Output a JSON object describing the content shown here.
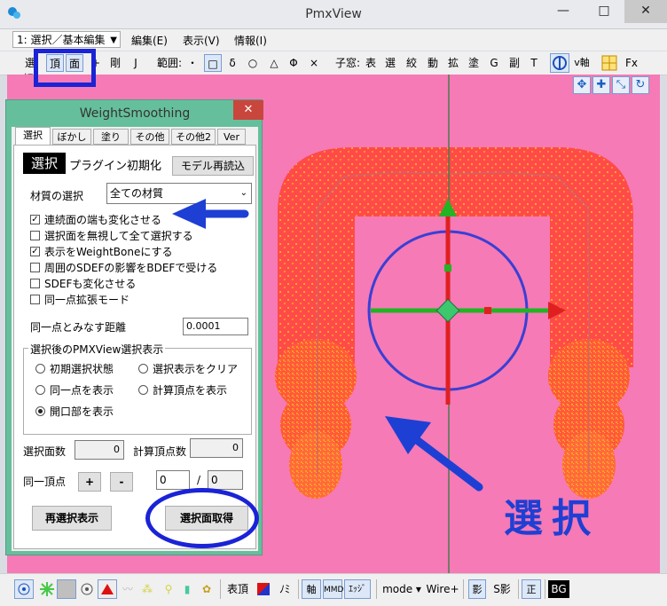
{
  "window": {
    "title": "PmxView",
    "minimize": "—",
    "maximize": "□",
    "close": "✕"
  },
  "menu": {
    "mode_select": "1: 選択／基本編集",
    "items": [
      "編集(E)",
      "表示(V)",
      "情報(I)"
    ]
  },
  "toolbar": {
    "select_label": "選択:",
    "vertex": "頂",
    "face": "面",
    "plus": "+",
    "rigid": "剛",
    "joint": "J",
    "range_label": "範囲:",
    "range_items": [
      "・",
      "□",
      "δ",
      "○",
      "△",
      "Φ",
      "×"
    ],
    "child_label": "子窓:",
    "child_items": [
      "表",
      "選",
      "絞",
      "動",
      "拡",
      "塗",
      "G",
      "副",
      "T"
    ],
    "axis": "v軸",
    "fx": "Fx"
  },
  "dialog": {
    "title": "WeightSmoothing",
    "close": "✕",
    "tabs": [
      "選択",
      "ぼかし",
      "塗り",
      "その他",
      "その他2",
      "Ver"
    ],
    "select_label": "選択",
    "plugin_init": "プラグイン初期化",
    "reload_button": "モデル再読込",
    "material_label": "材質の選択",
    "material_value": "全ての材質",
    "checkboxes": [
      {
        "label": "連続面の端も変化させる",
        "checked": true
      },
      {
        "label": "選択面を無視して全て選択する",
        "checked": false
      },
      {
        "label": "表示をWeightBoneにする",
        "checked": true
      },
      {
        "label": "周囲のSDEFの影響をBDEFで受ける",
        "checked": false
      },
      {
        "label": "SDEFも変化させる",
        "checked": false
      },
      {
        "label": "同一点拡張モード",
        "checked": false
      }
    ],
    "same_point_label": "同一点とみなす距離",
    "same_point_value": "0.0001",
    "group_title": "選択後のPMXView選択表示",
    "radios": [
      {
        "label": "初期選択状態",
        "checked": false
      },
      {
        "label": "選択表示をクリア",
        "checked": false
      },
      {
        "label": "同一点を表示",
        "checked": false
      },
      {
        "label": "計算頂点を表示",
        "checked": false
      },
      {
        "label": "開口部を表示",
        "checked": true
      }
    ],
    "face_count_label": "選択面数",
    "face_count_value": "0",
    "calc_count_label": "計算頂点数",
    "calc_count_value": "0",
    "same_vertex_label": "同一頂点",
    "plus_btn": "+",
    "minus_btn": "-",
    "index_value": "0",
    "slash": "/",
    "total_value": "0",
    "reselect_button": "再選択表示",
    "get_faces_button": "選択面取得"
  },
  "annotation": {
    "text": "選択"
  },
  "statusbar": {
    "vertex": "表頂",
    "no": "ﾉﾐ",
    "axis": "軸",
    "mmd": "MMD",
    "edge": "ｴｯｼﾞ",
    "mode": "mode ▾",
    "wire": "Wire+",
    "shadow": "影",
    "sshadow": "S影",
    "front": "正",
    "bg": "BG"
  },
  "colors": {
    "viewport": "#f57ab6",
    "mesh": "#ff4a4a",
    "annotation": "#1e3fd4",
    "dialog": "#66bf9c"
  }
}
